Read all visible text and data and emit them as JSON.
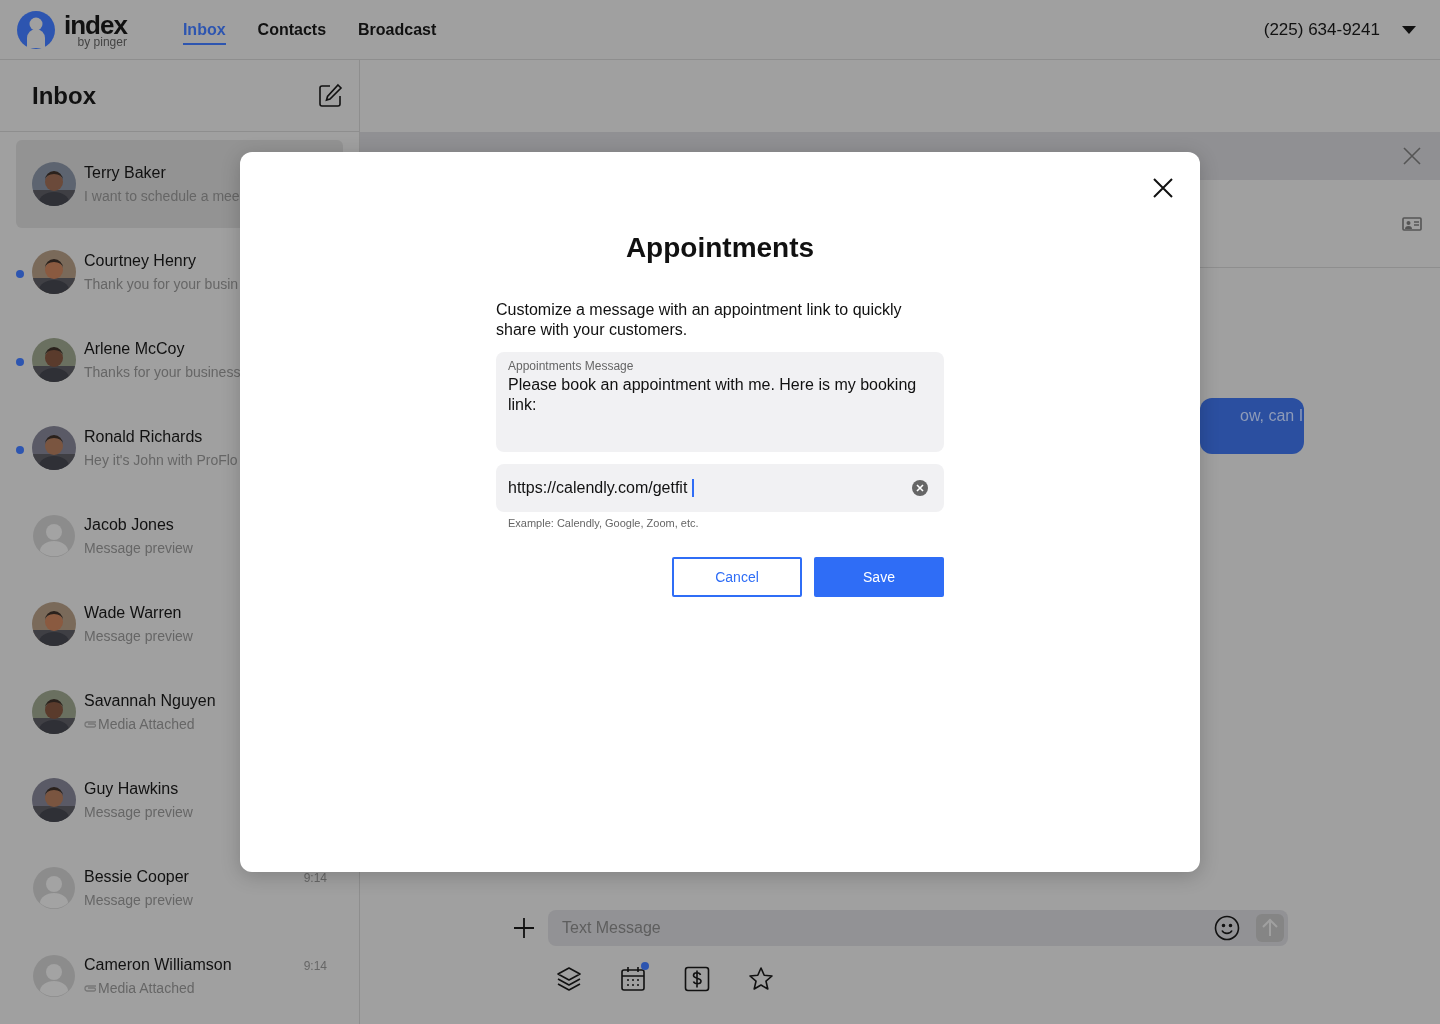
{
  "header": {
    "logo": {
      "name": "index",
      "tagline": "by pinger"
    },
    "nav": [
      {
        "label": "Inbox",
        "selected": true
      },
      {
        "label": "Contacts",
        "selected": false
      },
      {
        "label": "Broadcast",
        "selected": false
      }
    ],
    "phone": "(225) 634-9241"
  },
  "sidebar": {
    "title": "Inbox",
    "conversations": [
      {
        "name": "Terry Baker",
        "preview": "I want to schedule a mee",
        "unread": false,
        "selected": true,
        "attachment": false
      },
      {
        "name": "Courtney Henry",
        "preview": "Thank you for your busin",
        "unread": true,
        "selected": false,
        "attachment": false
      },
      {
        "name": "Arlene McCoy",
        "preview": "Thanks for your business",
        "unread": true,
        "selected": false,
        "attachment": false
      },
      {
        "name": "Ronald Richards",
        "preview": "Hey it's John with ProFlo",
        "unread": true,
        "selected": false,
        "attachment": false
      },
      {
        "name": "Jacob Jones",
        "preview": "Message preview",
        "kind": "placeholder",
        "unread": false,
        "selected": false,
        "attachment": false
      },
      {
        "name": "Wade Warren",
        "preview": "Message preview",
        "unread": false,
        "selected": false,
        "attachment": false
      },
      {
        "name": "Savannah Nguyen",
        "preview": "Media Attached",
        "unread": false,
        "selected": false,
        "attachment": true
      },
      {
        "name": "Guy Hawkins",
        "preview": "Message preview",
        "unread": false,
        "selected": false,
        "attachment": false
      },
      {
        "name": "Bessie Cooper",
        "preview": "Message preview",
        "time": "9:14",
        "kind": "placeholder",
        "unread": false,
        "selected": false,
        "attachment": false
      },
      {
        "name": "Cameron Williamson",
        "preview": "Media Attached",
        "time": "9:14",
        "kind": "placeholder",
        "unread": false,
        "selected": false,
        "attachment": true
      }
    ]
  },
  "chat": {
    "bubble": "ow, can I",
    "composer": {
      "placeholder": "Text Message"
    },
    "calendar_badge": true
  },
  "modal": {
    "title": "Appointments",
    "description": "Customize a message with an appointment link to quickly share with your customers.",
    "message_field": {
      "label": "Appointments Message",
      "value": "Please book an appointment with me. Here is my booking link:"
    },
    "link_field": {
      "value": "https://calendly.com/getfit",
      "hint": "Example: Calendly, Google, Zoom, etc."
    },
    "buttons": [
      {
        "label": "Cancel",
        "kind": "secondary"
      },
      {
        "label": "Save",
        "kind": "primary"
      }
    ]
  }
}
